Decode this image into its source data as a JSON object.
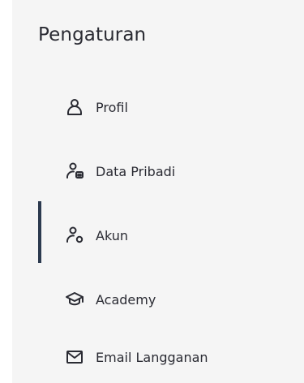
{
  "sidebar": {
    "title": "Pengaturan",
    "active_index": 2,
    "items": [
      {
        "label": "Profil",
        "icon": "user-icon"
      },
      {
        "label": "Data Pribadi",
        "icon": "user-card-icon"
      },
      {
        "label": "Akun",
        "icon": "user-settings-icon"
      },
      {
        "label": "Academy",
        "icon": "graduation-cap-icon"
      },
      {
        "label": "Email Langganan",
        "icon": "mail-icon"
      }
    ]
  },
  "colors": {
    "background": "#f5f5f5",
    "text": "#2a2b33",
    "active_indicator": "#2c3a4f"
  }
}
